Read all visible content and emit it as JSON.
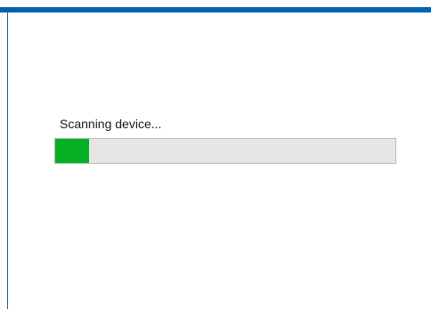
{
  "colors": {
    "accent": "#0063b1",
    "progress_fill": "#06b025"
  },
  "status": {
    "text": "Scanning device..."
  },
  "progress": {
    "fraction": 0.1
  }
}
